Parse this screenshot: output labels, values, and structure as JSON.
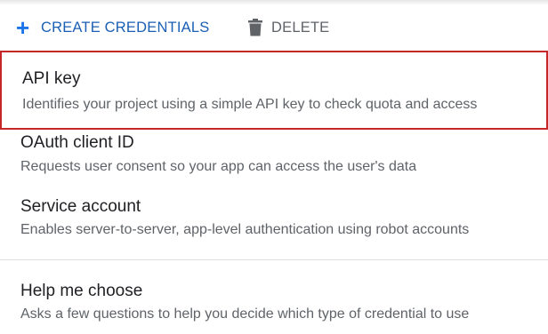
{
  "toolbar": {
    "create_icon": "plus-icon",
    "create_label": "CREATE CREDENTIALS",
    "delete_icon": "trash-icon",
    "delete_label": "DELETE"
  },
  "menu": {
    "items": [
      {
        "title": "API key",
        "description": "Identifies your project using a simple API key to check quota and access",
        "highlighted": true
      },
      {
        "title": "OAuth client ID",
        "description": "Requests user consent so your app can access the user's data"
      },
      {
        "title": "Service account",
        "description": "Enables server-to-server, app-level authentication using robot accounts"
      },
      {
        "title": "Help me choose",
        "description": "Asks a few questions to help you decide which type of credential to use"
      }
    ]
  },
  "colors": {
    "accent": "#1a73e8",
    "highlight_border": "#c62828",
    "title_text": "#202124",
    "secondary_text": "#5f6368",
    "divider": "#e0e0e0"
  }
}
